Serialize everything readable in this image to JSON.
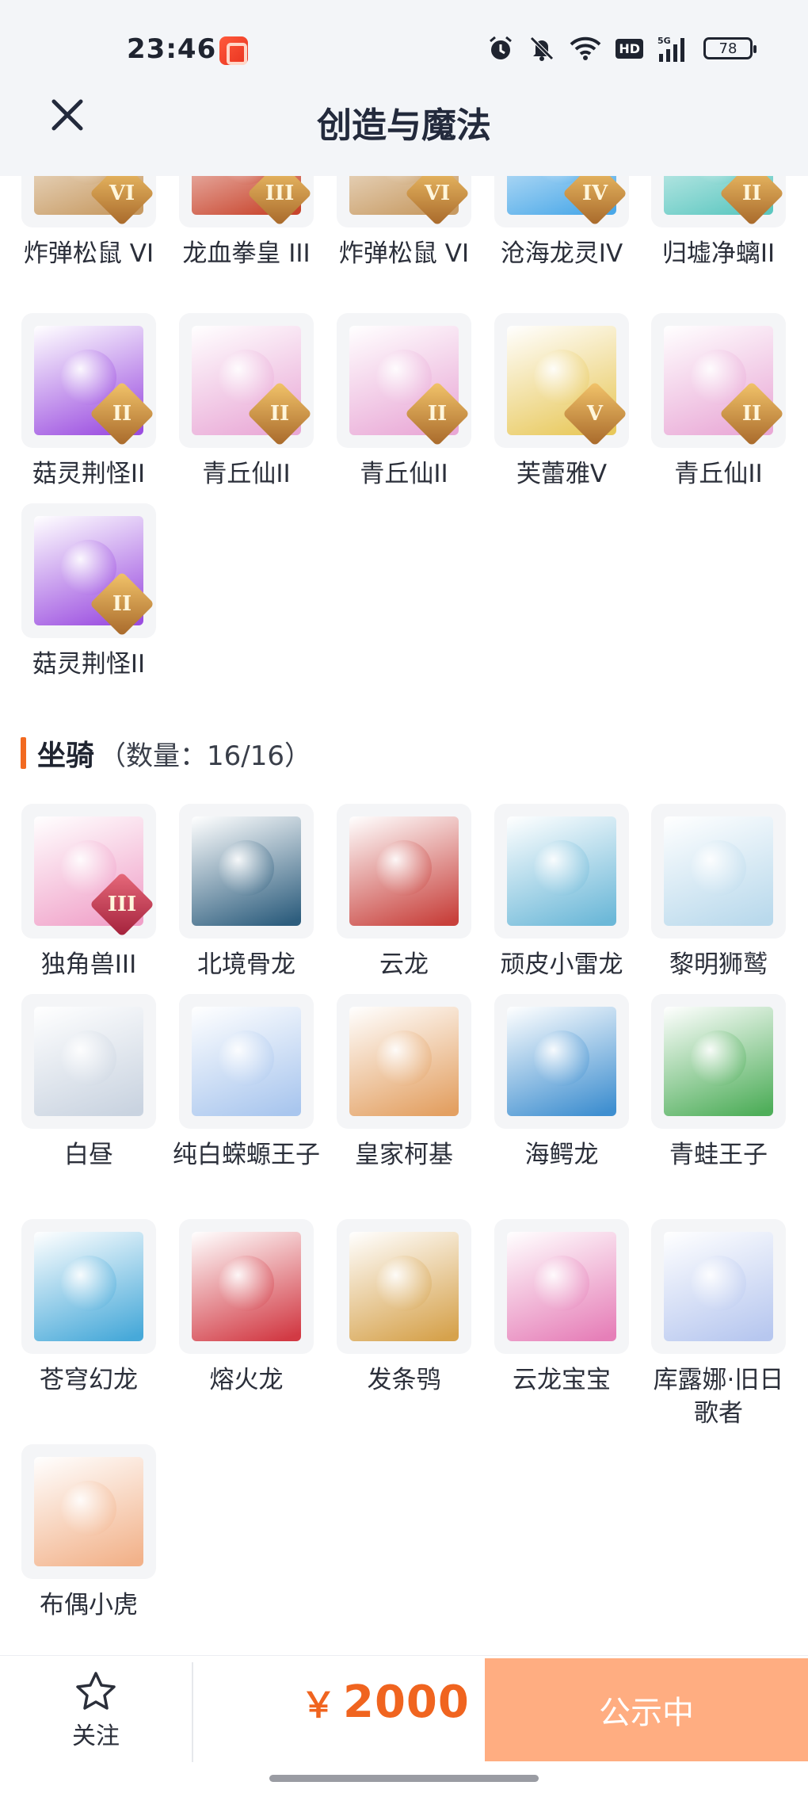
{
  "status_bar": {
    "time": "23:46",
    "battery": "78",
    "hd": "HD",
    "network": "5G",
    "icons": [
      "alarm-icon",
      "mute-icon",
      "wifi-icon",
      "hd-icon",
      "signal-icon",
      "battery-icon"
    ]
  },
  "header": {
    "title": "创造与魔法",
    "close_icon": "close-icon"
  },
  "pets_partial": [
    {
      "label": "炸弹松鼠 VI",
      "rank": "VI",
      "color": "#c79a62"
    },
    {
      "label": "龙血拳皇 III",
      "rank": "III",
      "color": "#c8442c"
    },
    {
      "label": "炸弹松鼠 VI",
      "rank": "VI",
      "color": "#c79a62"
    },
    {
      "label": "沧海龙灵IV",
      "rank": "IV",
      "color": "#4aa8e8"
    },
    {
      "label": "归墟净螭II",
      "rank": "II",
      "color": "#5cc7c0"
    },
    {
      "label": "菇灵荆怪II",
      "rank": "II",
      "color": "#9b4de0"
    },
    {
      "label": "青丘仙II",
      "rank": "II",
      "color": "#e9a8d6"
    },
    {
      "label": "青丘仙II",
      "rank": "II",
      "color": "#e9a8d6"
    },
    {
      "label": "芙蕾雅V",
      "rank": "V",
      "color": "#e8c85a"
    },
    {
      "label": "青丘仙II",
      "rank": "II",
      "color": "#e9a8d6"
    },
    {
      "label": "菇灵荆怪II",
      "rank": "II",
      "color": "#9b4de0"
    }
  ],
  "mounts_section": {
    "title": "坐骑",
    "count_text": "（数量：16/16）"
  },
  "mounts": [
    {
      "label": "独角兽III",
      "rank": "III",
      "rank_style": "red",
      "color": "#f0a0c8"
    },
    {
      "label": "北境骨龙",
      "color": "#2e5e7e"
    },
    {
      "label": "云龙",
      "color": "#c8413c"
    },
    {
      "label": "顽皮小雷龙",
      "color": "#6cb8d8"
    },
    {
      "label": "黎明狮鹫",
      "color": "#b9d9ec"
    },
    {
      "label": "白昼",
      "color": "#c9d3e0"
    },
    {
      "label": "纯白蝾螈王子",
      "color": "#a9c6ee"
    },
    {
      "label": "皇家柯基",
      "color": "#e3a062"
    },
    {
      "label": "海鳄龙",
      "color": "#3f8fd0"
    },
    {
      "label": "青蛙王子",
      "color": "#4fae5a"
    },
    {
      "label": "苍穹幻龙",
      "color": "#47a9d9"
    },
    {
      "label": "熔火龙",
      "color": "#d23a44"
    },
    {
      "label": "发条鸮",
      "color": "#d6a24c"
    },
    {
      "label": "云龙宝宝",
      "color": "#e67fb8"
    },
    {
      "label": "库露娜·旧日歌者",
      "color": "#b7c7ef"
    },
    {
      "label": "布偶小虎",
      "color": "#f2b28a"
    }
  ],
  "bottom_bar": {
    "follow_label": "关注",
    "star_icon": "star-icon",
    "currency": "￥",
    "price": "2000",
    "status_label": "公示中",
    "accent": "#f0641f",
    "status_color": "#ffad81"
  }
}
